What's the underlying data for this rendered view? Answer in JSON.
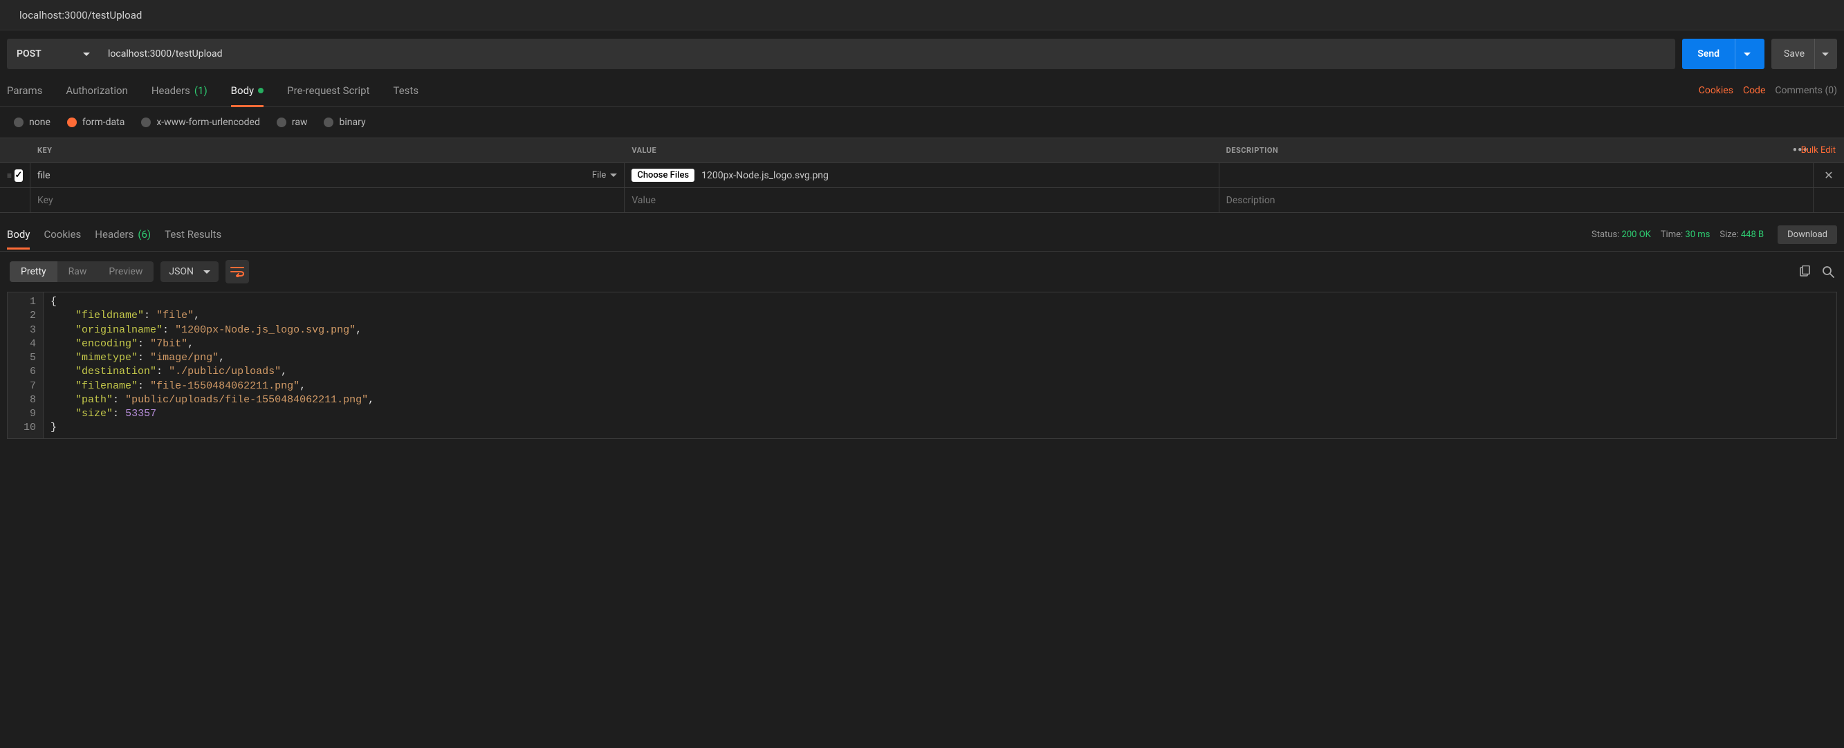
{
  "title": "localhost:3000/testUpload",
  "request": {
    "method": "POST",
    "url": "localhost:3000/testUpload",
    "send_label": "Send",
    "save_label": "Save"
  },
  "req_tabs": {
    "params": "Params",
    "authorization": "Authorization",
    "headers": "Headers",
    "headers_count": "(1)",
    "body": "Body",
    "pre_request": "Pre-request Script",
    "tests": "Tests"
  },
  "right_links": {
    "cookies": "Cookies",
    "code": "Code",
    "comments": "Comments (0)"
  },
  "body_types": {
    "none": "none",
    "form_data": "form-data",
    "xwww": "x-www-form-urlencoded",
    "raw": "raw",
    "binary": "binary"
  },
  "kv": {
    "head_key": "KEY",
    "head_value": "VALUE",
    "head_description": "DESCRIPTION",
    "bulk_edit": "Bulk Edit",
    "rows": [
      {
        "enabled": true,
        "key": "file",
        "type": "File",
        "choose_label": "Choose Files",
        "filename": "1200px-Node.js_logo.svg.png",
        "description": ""
      }
    ],
    "placeholder_key": "Key",
    "placeholder_value": "Value",
    "placeholder_description": "Description"
  },
  "resp_tabs": {
    "body": "Body",
    "cookies": "Cookies",
    "headers": "Headers",
    "headers_count": "(6)",
    "test_results": "Test Results"
  },
  "resp_meta": {
    "status_label": "Status:",
    "status_value": "200 OK",
    "time_label": "Time:",
    "time_value": "30 ms",
    "size_label": "Size:",
    "size_value": "448 B",
    "download": "Download"
  },
  "resp_toolbar": {
    "pretty": "Pretty",
    "raw": "Raw",
    "preview": "Preview",
    "format": "JSON"
  },
  "response_json": {
    "fieldname": "file",
    "originalname": "1200px-Node.js_logo.svg.png",
    "encoding": "7bit",
    "mimetype": "image/png",
    "destination": "./public/uploads",
    "filename": "file-1550484062211.png",
    "path": "public/uploads/file-1550484062211.png",
    "size": 53357
  }
}
